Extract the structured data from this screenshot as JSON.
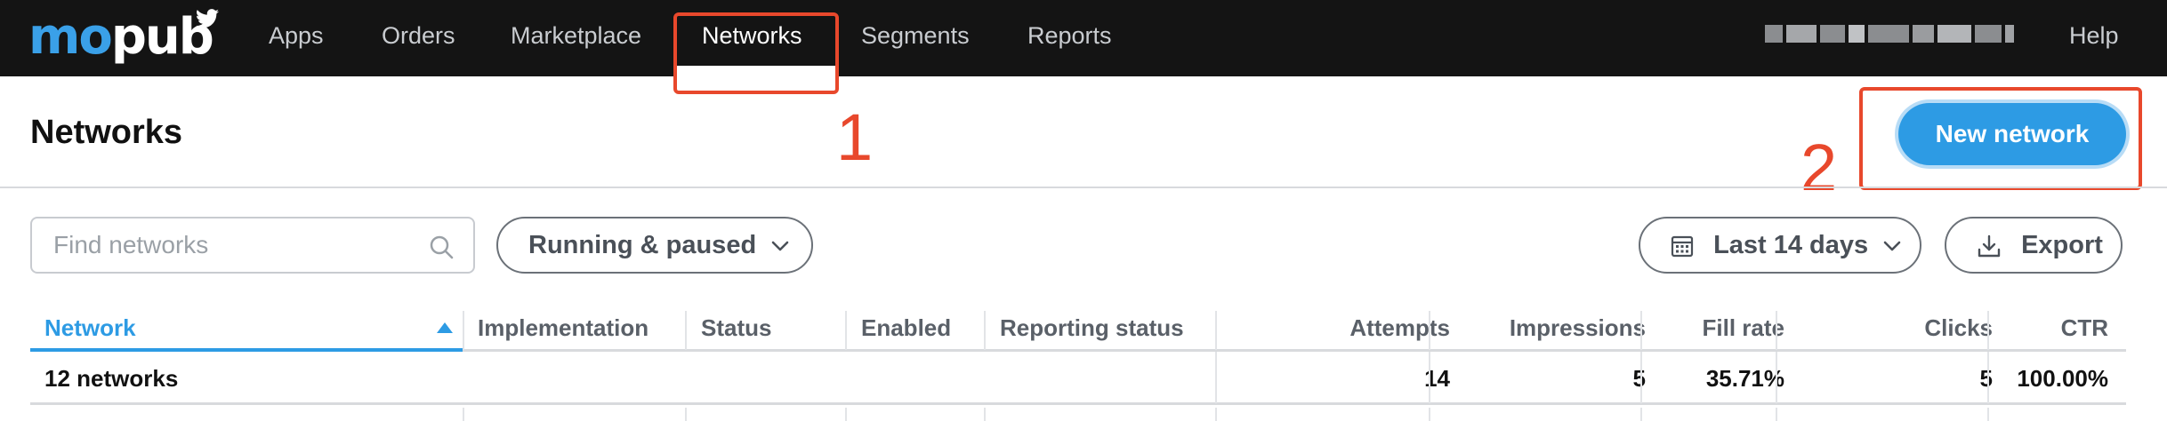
{
  "nav": {
    "logo_mo": "mo",
    "logo_pub": "pub",
    "items": [
      {
        "label": "Apps"
      },
      {
        "label": "Orders"
      },
      {
        "label": "Marketplace"
      },
      {
        "label": "Networks",
        "active": true
      },
      {
        "label": "Segments"
      },
      {
        "label": "Reports"
      }
    ],
    "help": "Help"
  },
  "annotations": {
    "one": "1",
    "two": "2",
    "color": "#e8482c"
  },
  "header": {
    "title": "Networks",
    "new_button": "New network"
  },
  "filters": {
    "search_placeholder": "Find networks",
    "status": "Running & paused",
    "date_range": "Last 14 days",
    "export": "Export"
  },
  "table": {
    "columns": [
      "Network",
      "Implementation",
      "Status",
      "Enabled",
      "Reporting status",
      "Attempts",
      "Impressions",
      "Fill rate",
      "Clicks",
      "CTR"
    ],
    "sorted_column": "Network",
    "summary": {
      "label": "12 networks",
      "attempts": "14",
      "impressions": "5",
      "fill_rate": "35.71%",
      "clicks": "5",
      "ctr": "100.00%"
    }
  },
  "colors": {
    "accent": "#2d9be4",
    "nav_bg": "#141414",
    "annotation": "#e8482c"
  }
}
